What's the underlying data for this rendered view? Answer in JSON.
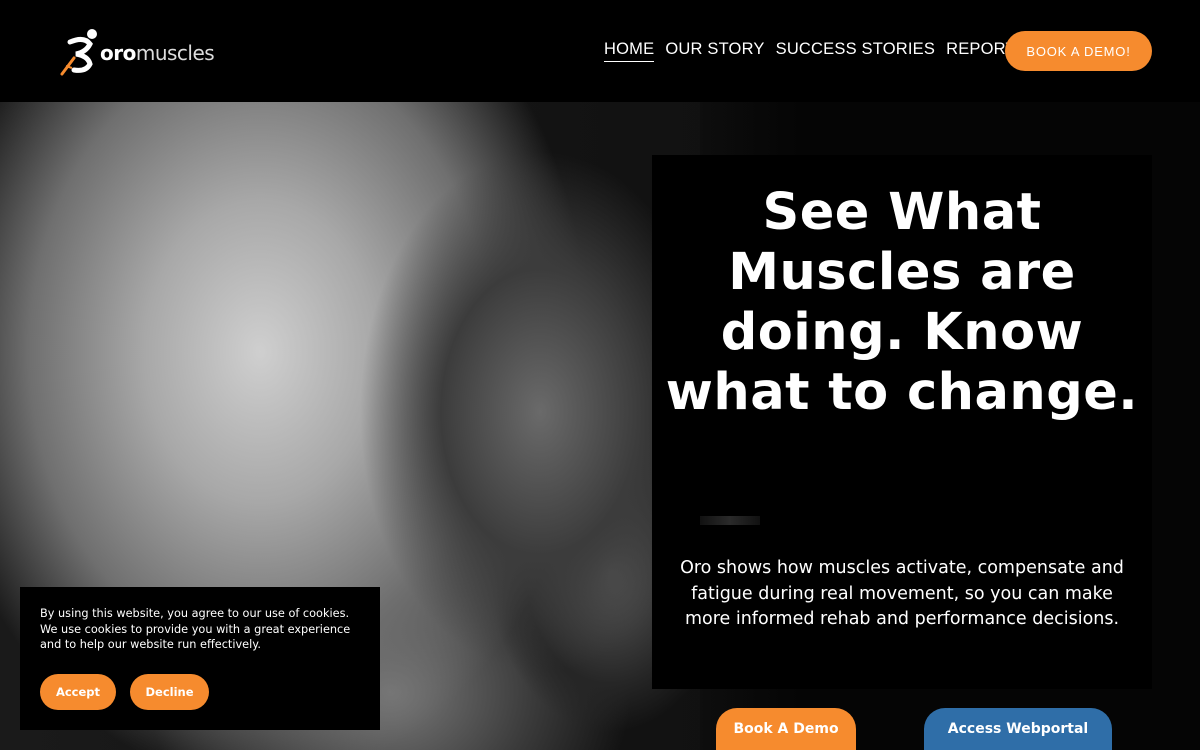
{
  "brand": {
    "name_bold": "oro",
    "name_light": "muscles",
    "logo_icon": "running-figure-icon",
    "accent_color": "#f68b2e",
    "secondary_color": "#2f6ea8"
  },
  "nav": {
    "items": [
      {
        "label": "HOME",
        "active": true
      },
      {
        "label": "OUR STORY",
        "active": false
      },
      {
        "label": "SUCCESS STORIES",
        "active": false
      },
      {
        "label": "REPORTS",
        "active": false
      }
    ],
    "cta_label": "BOOK A DEMO!"
  },
  "hero": {
    "title": "See What Muscles are doing. Know what to change.",
    "subtitle": "Oro shows how muscles activate, compensate and fatigue during real movement, so you can make more informed rehab and performance decisions.",
    "primary_button": "Book A Demo",
    "secondary_button": "Access Webportal"
  },
  "cookie_banner": {
    "text": "By using this website, you agree to our use of cookies. We use cookies to provide you with a great experience and to help our website run effectively.",
    "accept_label": "Accept",
    "decline_label": "Decline"
  }
}
